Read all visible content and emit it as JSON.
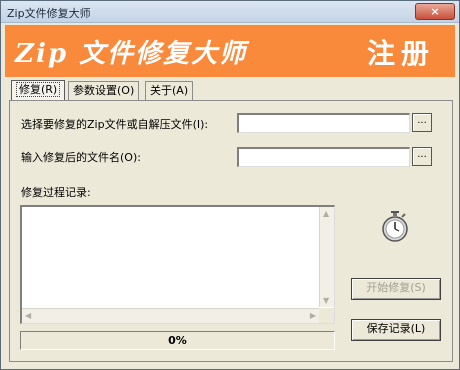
{
  "window": {
    "title": "Zip文件修复大师",
    "close_label": "×"
  },
  "banner": {
    "title": "Zip 文件修复大师",
    "register": "注册"
  },
  "tabs": [
    {
      "label": "修复(R)"
    },
    {
      "label": "参数设置(O)"
    },
    {
      "label": "关于(A)"
    }
  ],
  "form": {
    "source_label": "选择要修复的Zip文件或自解压文件(I):",
    "source_value": "",
    "target_label": "输入修复后的文件名(O):",
    "target_value": "",
    "browse_label": "...",
    "log_label": "修复过程记录:",
    "log_value": ""
  },
  "buttons": {
    "start": "开始修复(S)",
    "save_log": "保存记录(L)"
  },
  "progress": {
    "value": 0,
    "text": "0%"
  },
  "icons": {
    "timer": "stopwatch-icon",
    "close": "close-icon"
  },
  "colors": {
    "banner": "#f98a3b",
    "titlebar": "#c3d3e6",
    "progress_fill": "#316ac5"
  }
}
